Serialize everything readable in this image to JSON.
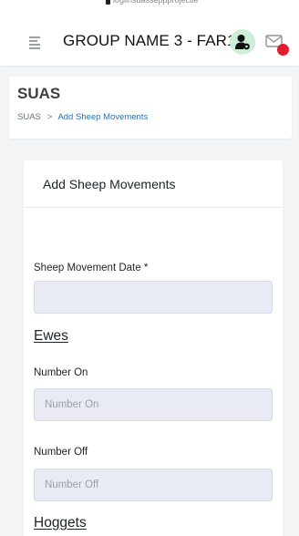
{
  "browser": {
    "url_fragment": "logiinsuasseppprojectie"
  },
  "header": {
    "group_name": "GROUP NAME 3 -  FAR1",
    "icons": [
      "hamburger-menu-icon",
      "user-settings-icon",
      "mail-icon"
    ],
    "user_icon_bg": "#cdeed9",
    "notification_color": "#e11d2e"
  },
  "page": {
    "title": "SUAS",
    "breadcrumb": {
      "root": "SUAS",
      "separator": ">",
      "current": "Add Sheep Movements"
    }
  },
  "card": {
    "title": "Add Sheep Movements",
    "fields": {
      "movement_date": {
        "label": "Sheep Movement Date *",
        "value": "",
        "placeholder": ""
      },
      "ewes_number_on": {
        "label": "Number On",
        "value": "",
        "placeholder": "Number On"
      },
      "ewes_number_off": {
        "label": "Number Off",
        "value": "",
        "placeholder": "Number Off"
      }
    },
    "sections": {
      "ewes": "Ewes",
      "hoggets": "Hoggets"
    }
  },
  "colors": {
    "link": "#2f6fb0",
    "input_bg": "#e9ebf4",
    "page_bg": "#f3f4f6"
  }
}
